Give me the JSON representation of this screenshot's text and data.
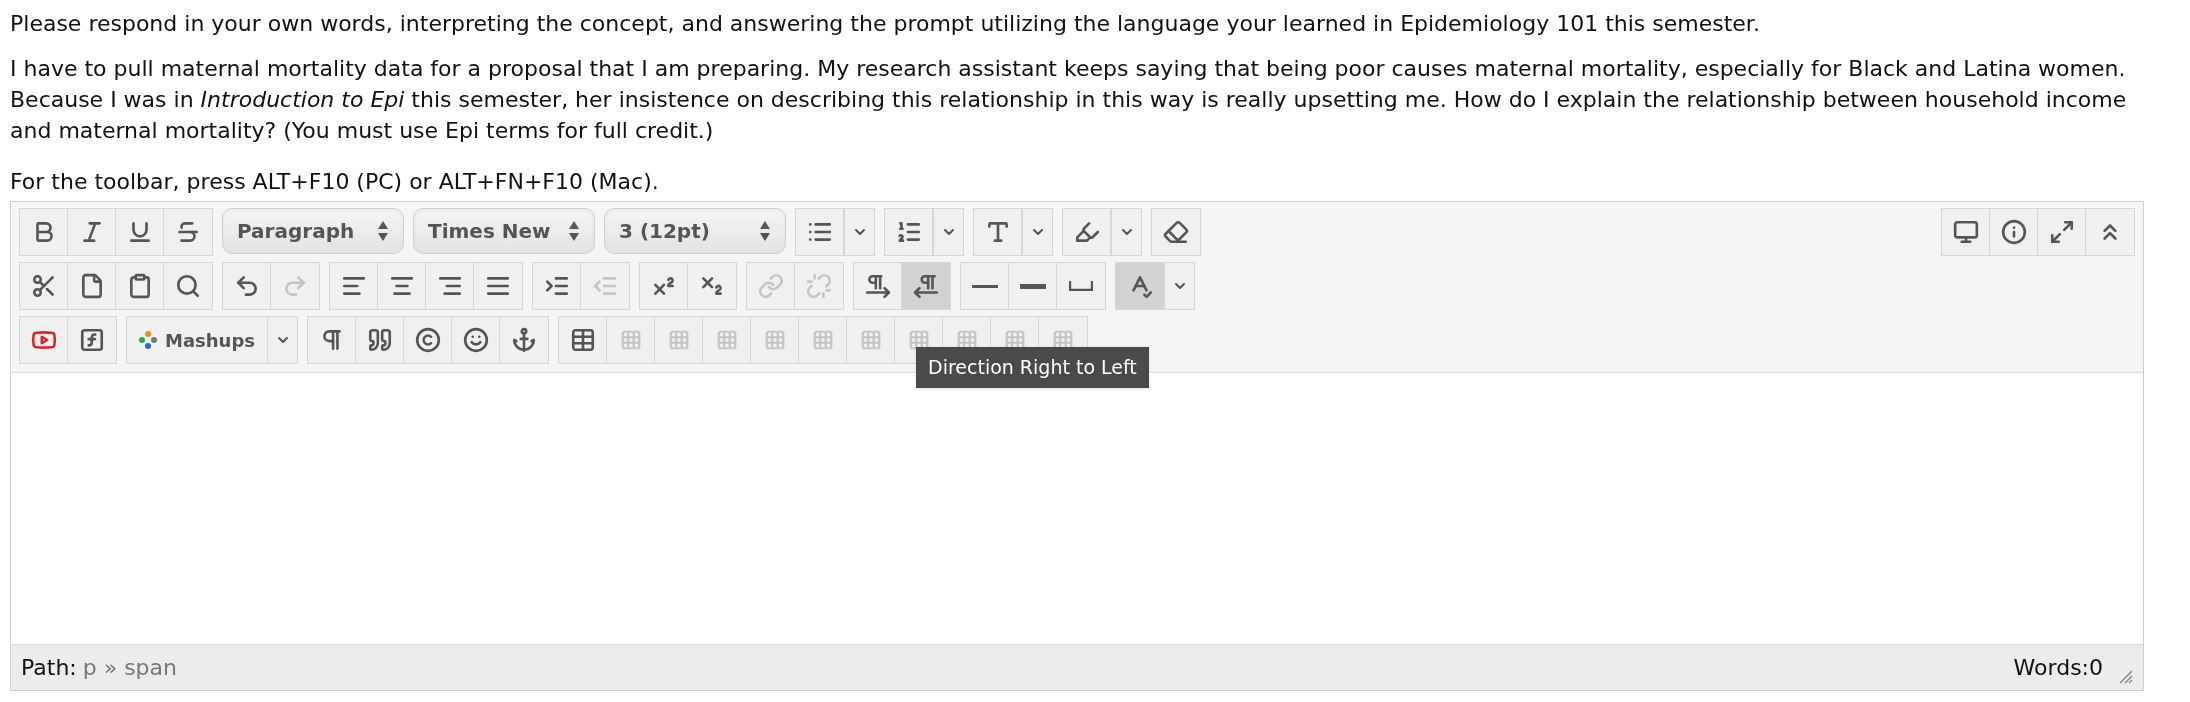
{
  "instructions": "Please respond in your own words, interpreting the concept, and answering the prompt utilizing the language your learned in Epidemiology 101 this semester.",
  "prompt": "I have to pull  maternal mortality data for a proposal that I am preparing. My research assistant keeps saying that being poor causes maternal mortality, especially for Black and Latina women. Because I was in *Introduction to Epi* this semester, her insistence on describing this relationship in this way is really upsetting me. How do I explain the relationship between household income and maternal mortality? (You must use Epi terms for full credit.)",
  "toolbar_hint": "For the toolbar, press ALT+F10 (PC) or ALT+FN+F10 (Mac).",
  "editor": {
    "rows": [
      {
        "groups": [
          {
            "kind": "buttons",
            "buttons": [
              {
                "disabled": false,
                "active": false
              },
              {
                "disabled": false,
                "active": false
              },
              {
                "disabled": false,
                "active": false
              },
              {
                "disabled": false,
                "active": false
              }
            ]
          },
          {
            "kind": "select",
            "value": "Paragraph"
          },
          {
            "kind": "select",
            "value": "Times New"
          },
          {
            "kind": "select",
            "value": "3 (12pt)"
          },
          {
            "kind": "split",
            "buttons": [
              {
                "disabled": false,
                "active": false
              }
            ]
          },
          {
            "kind": "split",
            "buttons": [
              {
                "disabled": false,
                "active": false
              }
            ]
          },
          {
            "kind": "split",
            "buttons": [
              {
                "disabled": false,
                "active": false
              }
            ]
          },
          {
            "kind": "split",
            "buttons": [
              {
                "disabled": false,
                "active": false
              }
            ]
          },
          {
            "kind": "buttons",
            "buttons": [
              {
                "disabled": false,
                "active": false
              }
            ]
          }
        ],
        "right": [
          {
            "disabled": false,
            "active": false
          },
          {
            "disabled": false,
            "active": false
          },
          {
            "disabled": false,
            "active": false
          },
          {
            "disabled": false,
            "active": false
          }
        ]
      },
      {
        "groups": [
          {
            "kind": "buttons",
            "buttons": [
              {
                "disabled": false,
                "active": false
              },
              {
                "disabled": false,
                "active": false
              },
              {
                "disabled": false,
                "active": false
              },
              {
                "disabled": false,
                "active": false
              }
            ]
          },
          {
            "kind": "buttons",
            "buttons": [
              {
                "disabled": false,
                "active": false
              },
              {
                "disabled": true,
                "active": false
              }
            ]
          },
          {
            "kind": "buttons",
            "buttons": [
              {
                "disabled": false,
                "active": false
              },
              {
                "disabled": false,
                "active": false
              },
              {
                "disabled": false,
                "active": false
              },
              {
                "disabled": false,
                "active": false
              }
            ]
          },
          {
            "kind": "buttons",
            "buttons": [
              {
                "disabled": false,
                "active": false
              },
              {
                "disabled": true,
                "active": false
              }
            ]
          },
          {
            "kind": "buttons",
            "buttons": [
              {
                "disabled": false,
                "active": false
              },
              {
                "disabled": false,
                "active": false
              }
            ]
          },
          {
            "kind": "buttons",
            "buttons": [
              {
                "disabled": true,
                "active": false
              },
              {
                "disabled": true,
                "active": false
              }
            ]
          },
          {
            "kind": "buttons",
            "buttons": [
              {
                "disabled": false,
                "active": false
              },
              {
                "disabled": false,
                "active": true
              }
            ]
          },
          {
            "kind": "buttons",
            "buttons": [
              {
                "disabled": false,
                "active": false
              },
              {
                "disabled": false,
                "active": false
              },
              {
                "disabled": false,
                "active": false
              }
            ]
          },
          {
            "kind": "split",
            "buttons": [
              {
                "disabled": false,
                "active": true
              }
            ]
          }
        ]
      },
      {
        "groups": [
          {
            "kind": "buttons",
            "buttons": [
              {
                "disabled": false,
                "active": false
              },
              {
                "disabled": false,
                "active": false
              }
            ]
          },
          {
            "kind": "mashups",
            "label": "Mashups"
          },
          {
            "kind": "buttons",
            "buttons": [
              {
                "disabled": false,
                "active": false
              },
              {
                "disabled": false,
                "active": false
              },
              {
                "disabled": false,
                "active": false
              },
              {
                "disabled": false,
                "active": false
              },
              {
                "disabled": false,
                "active": false
              }
            ]
          },
          {
            "kind": "buttons",
            "buttons": [
              {
                "disabled": false,
                "active": false
              },
              {
                "disabled": true,
                "active": false
              },
              {
                "disabled": true,
                "active": false
              },
              {
                "disabled": true,
                "active": false
              },
              {
                "disabled": true,
                "active": false
              },
              {
                "disabled": true,
                "active": false
              },
              {
                "disabled": true,
                "active": false
              },
              {
                "disabled": true,
                "active": false
              },
              {
                "disabled": true,
                "active": false
              },
              {
                "disabled": true,
                "active": false
              },
              {
                "disabled": true,
                "active": false
              }
            ]
          }
        ]
      }
    ],
    "tooltip": "Direction Right to Left",
    "status": {
      "path_label": "Path:",
      "path": "p » span",
      "words": "Words:0"
    }
  }
}
